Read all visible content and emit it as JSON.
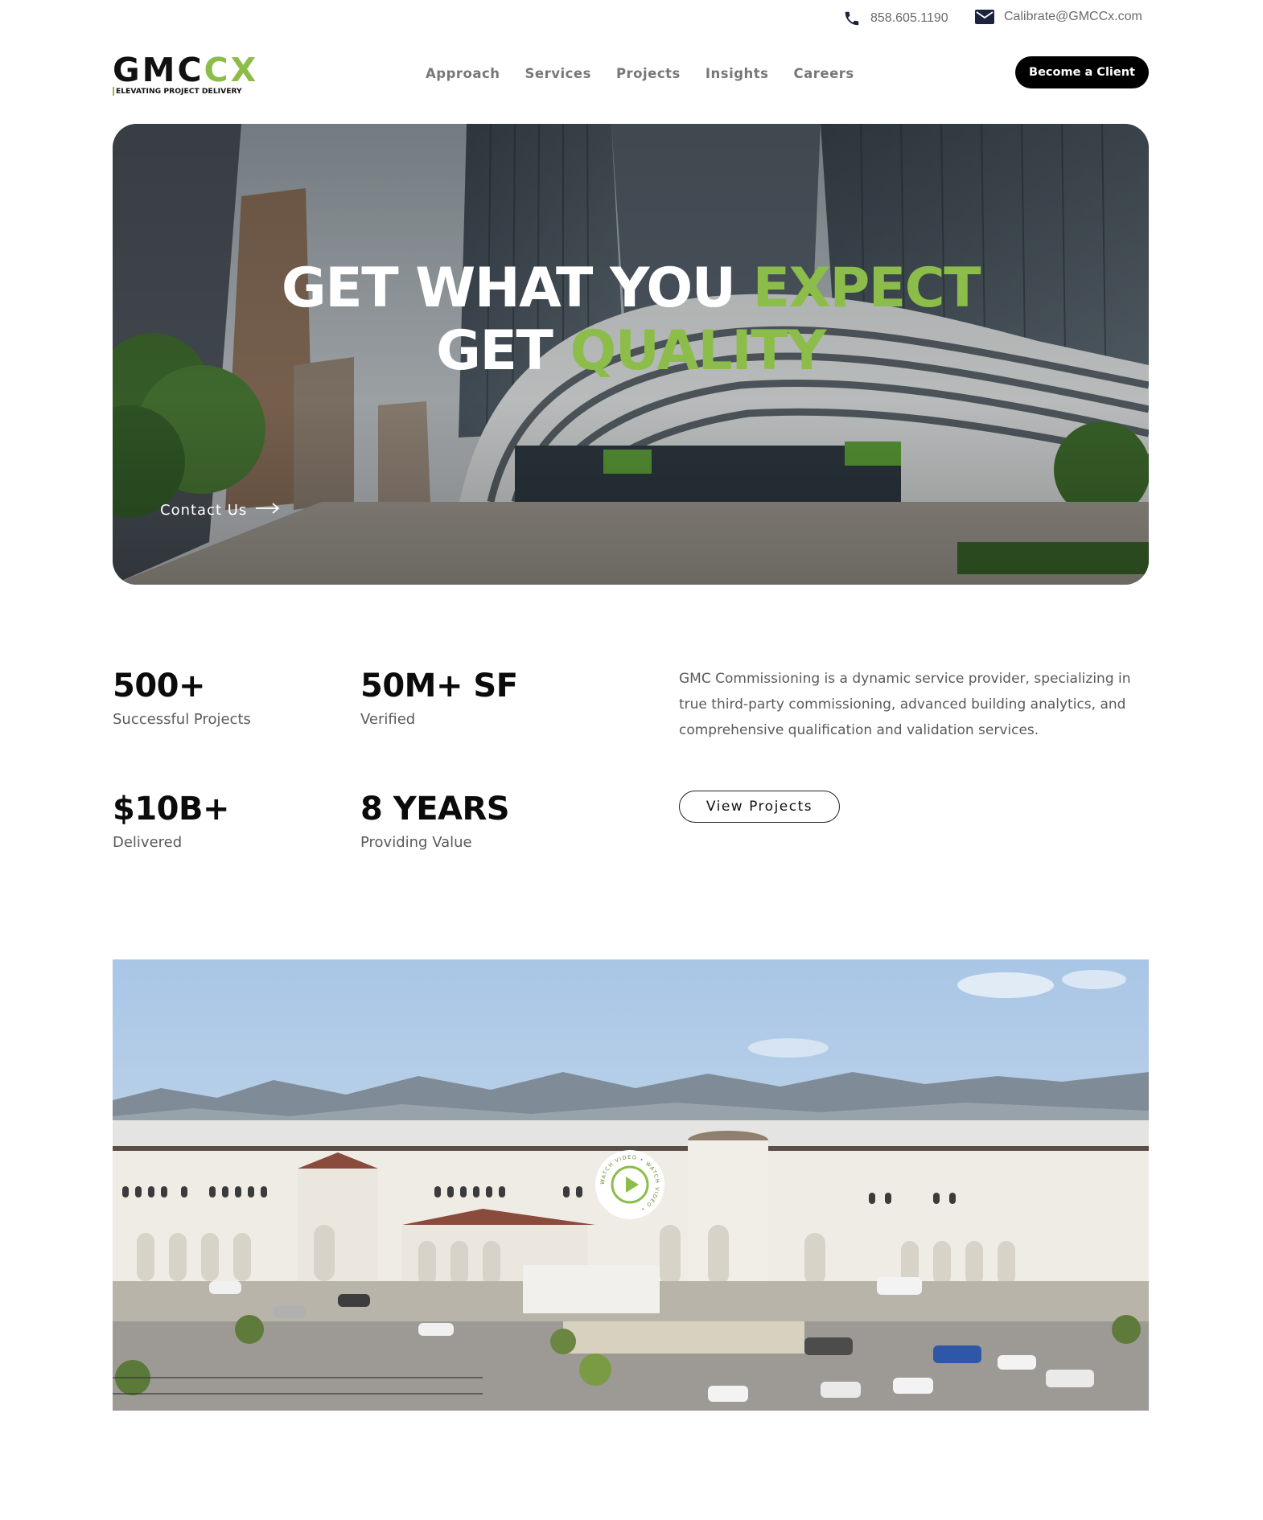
{
  "contact": {
    "phone": "858.605.1190",
    "email": "Calibrate@GMCCx.com",
    "phone_icon": "phone-icon",
    "email_icon": "mail-icon"
  },
  "logo": {
    "mark_dark": "GMC",
    "mark_green": "CX",
    "tagline": "ELEVATING PROJECT DELIVERY"
  },
  "nav": {
    "items": [
      {
        "label": "Approach"
      },
      {
        "label": "Services"
      },
      {
        "label": "Projects"
      },
      {
        "label": "Insights"
      },
      {
        "label": "Careers"
      }
    ],
    "cta_label": "Become a Client"
  },
  "hero": {
    "line1_white": "GET WHAT YOU ",
    "line1_accent": "EXPECT",
    "line2_white": "GET ",
    "line2_accent": "QUALITY",
    "contact_label": "Contact Us",
    "arrow_icon": "arrow-right-icon"
  },
  "stats": [
    {
      "value": "500+",
      "label": "Successful Projects"
    },
    {
      "value": "50M+ SF",
      "label": "Verified"
    },
    {
      "value": "$10B+",
      "label": "Delivered"
    },
    {
      "value": "8 YEARS",
      "label": "Providing Value"
    }
  ],
  "about": {
    "text": "GMC Commissioning is a dynamic service provider, specializing in true third-party commissioning, advanced building analytics, and comprehensive qualification and validation services.",
    "button_label": "View Projects"
  },
  "video": {
    "badge_text": "WATCH VIDEO • WATCH VIDEO •",
    "play_icon": "play-icon"
  },
  "colors": {
    "accent": "#8cbd4a",
    "text_dark": "#111111",
    "text_muted": "#5a5a5a",
    "nav_text": "#777777"
  }
}
